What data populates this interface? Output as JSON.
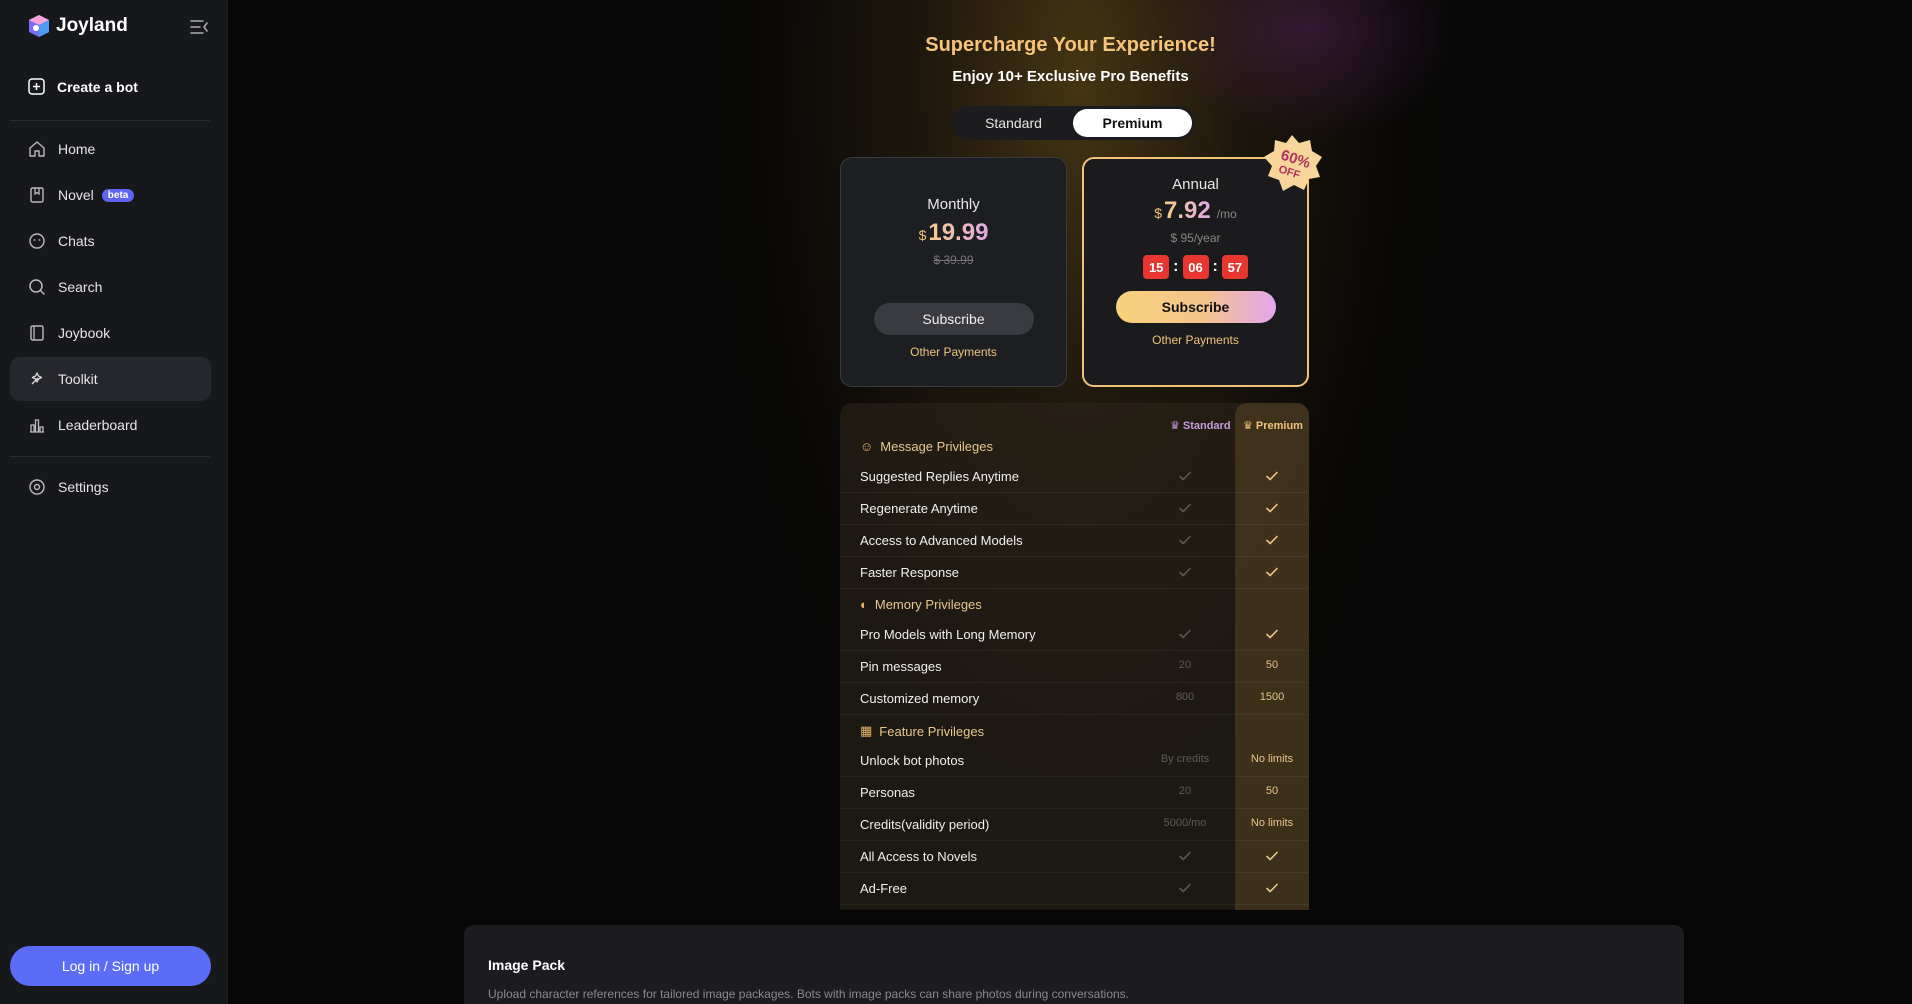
{
  "brand": {
    "name": "Joyland"
  },
  "sidebar": {
    "create_label": "Create a bot",
    "items": [
      {
        "label": "Home",
        "icon": "home-icon"
      },
      {
        "label": "Novel",
        "icon": "bookmark-icon",
        "badge": "beta"
      },
      {
        "label": "Chats",
        "icon": "chat-icon"
      },
      {
        "label": "Search",
        "icon": "search-icon"
      },
      {
        "label": "Joybook",
        "icon": "book-icon"
      },
      {
        "label": "Toolkit",
        "icon": "toolkit-icon"
      },
      {
        "label": "Leaderboard",
        "icon": "chart-icon"
      }
    ],
    "settings_label": "Settings",
    "login_label": "Log in / Sign up"
  },
  "hero": {
    "title": "Supercharge Your Experience!",
    "subtitle": "Enjoy 10+ Exclusive Pro Benefits",
    "toggle": {
      "standard": "Standard",
      "premium": "Premium"
    }
  },
  "plans": {
    "monthly": {
      "name": "Monthly",
      "currency": "$",
      "price": "19.99",
      "old_price": "$ 39.99",
      "subscribe": "Subscribe",
      "other": "Other Payments"
    },
    "annual": {
      "name": "Annual",
      "currency": "$",
      "price": "7.92",
      "per": "/mo",
      "yearly": "$ 95/year",
      "timer": [
        "15",
        "06",
        "57"
      ],
      "subscribe": "Subscribe",
      "other": "Other Payments",
      "badge_pct": "60%",
      "badge_off": "OFF"
    }
  },
  "table": {
    "col_standard": "Standard",
    "col_premium": "Premium",
    "sections": [
      {
        "title": "Message Privileges",
        "rows": [
          {
            "label": "Suggested Replies Anytime",
            "standard": "check",
            "premium": "check"
          },
          {
            "label": "Regenerate Anytime",
            "standard": "check",
            "premium": "check"
          },
          {
            "label": "Access to Advanced Models",
            "standard": "check",
            "premium": "check"
          },
          {
            "label": "Faster Response",
            "standard": "check",
            "premium": "check"
          }
        ]
      },
      {
        "title": "Memory Privileges",
        "rows": [
          {
            "label": "Pro Models with Long Memory",
            "standard": "check",
            "premium": "check"
          },
          {
            "label": "Pin messages",
            "standard": "20",
            "premium": "50"
          },
          {
            "label": "Customized memory",
            "standard": "800",
            "premium": "1500"
          }
        ]
      },
      {
        "title": "Feature Privileges",
        "rows": [
          {
            "label": "Unlock bot photos",
            "standard": "By credits",
            "premium": "No limits"
          },
          {
            "label": "Personas",
            "standard": "20",
            "premium": "50"
          },
          {
            "label": "Credits(validity period)",
            "standard": "5000/mo",
            "premium": "No limits"
          },
          {
            "label": "All Access to Novels",
            "standard": "check",
            "premium": "check"
          },
          {
            "label": "Ad-Free",
            "standard": "check",
            "premium": "check"
          }
        ]
      }
    ]
  },
  "image_pack": {
    "title": "Image Pack",
    "description": "Upload character references for tailored image packages. Bots with image packs can share photos during conversations."
  },
  "colors": {
    "accent_gold": "#f0c27a",
    "accent_blue": "#5b6cf7",
    "timer_red": "#e6362f"
  }
}
